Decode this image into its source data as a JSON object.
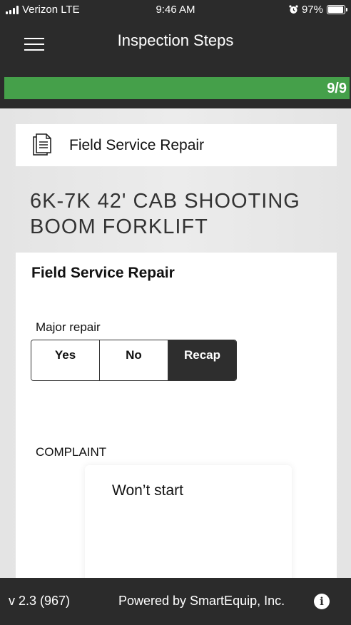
{
  "status_bar": {
    "carrier": "Verizon LTE",
    "time": "9:46 AM",
    "battery_percent": "97%",
    "battery_level": 0.97,
    "icons": [
      "signal-icon",
      "alarm-icon",
      "battery-icon"
    ]
  },
  "header": {
    "title": "Inspection Steps",
    "menu_icon": "hamburger-menu-icon"
  },
  "progress": {
    "label": "9/9",
    "fraction": 1.0,
    "color": "#45a04a"
  },
  "category": {
    "label": "Field Service Repair",
    "icon": "document-icon"
  },
  "equipment_title": "6K-7K 42' CAB SHOOTING BOOM FORKLIFT",
  "form": {
    "title": "Field Service Repair",
    "question": "Major repair",
    "options": [
      "Yes",
      "No",
      "Recap"
    ],
    "selected": "Recap",
    "complaint_label": "COMPLAINT",
    "complaint_value": "Won’t start"
  },
  "footer": {
    "version": "v 2.3 (967)",
    "powered_by": "Powered by SmartEquip, Inc.",
    "info_icon": "info-icon"
  },
  "colors": {
    "header_bg": "#2b2b2b",
    "accent": "#45a04a",
    "selected_segment": "#2e2e2e"
  }
}
